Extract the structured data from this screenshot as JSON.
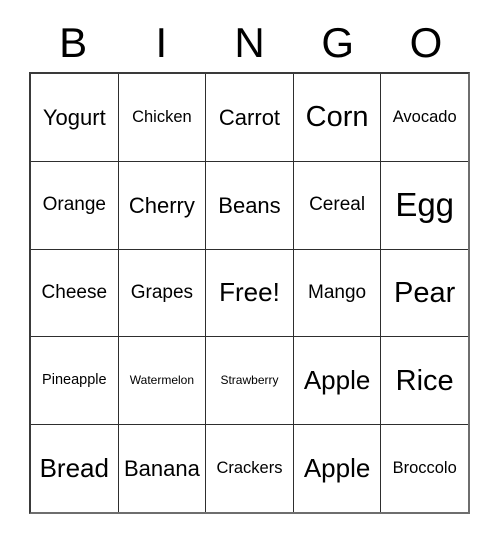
{
  "card": {
    "header_letters": [
      "B",
      "I",
      "N",
      "G",
      "O"
    ],
    "rows": [
      [
        {
          "label": "Yogurt",
          "size": "xl"
        },
        {
          "label": "Chicken",
          "size": "md"
        },
        {
          "label": "Carrot",
          "size": "xl"
        },
        {
          "label": "Corn",
          "size": "3xl"
        },
        {
          "label": "Avocado",
          "size": "md"
        }
      ],
      [
        {
          "label": "Orange",
          "size": "lg"
        },
        {
          "label": "Cherry",
          "size": "xl"
        },
        {
          "label": "Beans",
          "size": "xl"
        },
        {
          "label": "Cereal",
          "size": "lg"
        },
        {
          "label": "Egg",
          "size": "4xl"
        }
      ],
      [
        {
          "label": "Cheese",
          "size": "lg"
        },
        {
          "label": "Grapes",
          "size": "lg"
        },
        {
          "label": "Free!",
          "size": "2xl"
        },
        {
          "label": "Mango",
          "size": "lg"
        },
        {
          "label": "Pear",
          "size": "3xl"
        }
      ],
      [
        {
          "label": "Pineapple",
          "size": "sm"
        },
        {
          "label": "Watermelon",
          "size": "xs"
        },
        {
          "label": "Strawberry",
          "size": "xs"
        },
        {
          "label": "Apple",
          "size": "2xl"
        },
        {
          "label": "Rice",
          "size": "3xl"
        }
      ],
      [
        {
          "label": "Bread",
          "size": "2xl"
        },
        {
          "label": "Banana",
          "size": "xl"
        },
        {
          "label": "Crackers",
          "size": "md"
        },
        {
          "label": "Apple",
          "size": "2xl"
        },
        {
          "label": "Broccolo",
          "size": "md"
        }
      ]
    ],
    "free_space": {
      "row": 2,
      "column": 2,
      "label": "Free!"
    },
    "colors": {
      "background": "#ffffff",
      "text": "#000000",
      "grid_line": "#2e2e2e",
      "outer_border": "#3a3a3a"
    }
  }
}
